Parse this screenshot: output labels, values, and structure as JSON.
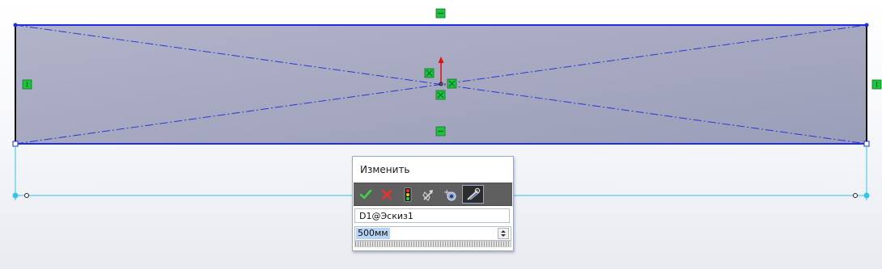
{
  "modify_dialog": {
    "title": "Изменить",
    "toolbar": {
      "ok": "check-icon",
      "cancel": "close-icon",
      "rebuild": "traffic-light-icon",
      "reverse": "reverse-dimension-icon",
      "mark": "mark-dimension-icon",
      "active_tool": "key-sketch-icon"
    },
    "dimension_name": "D1@Эскиз1",
    "value": "500мм"
  },
  "colors": {
    "sketch_line": "#1f2ee0",
    "rectangle_fill": "#a5a8c2",
    "relation_green": "#20c040",
    "dimension_cyan": "#33c5e8",
    "origin_red": "#e01010"
  }
}
